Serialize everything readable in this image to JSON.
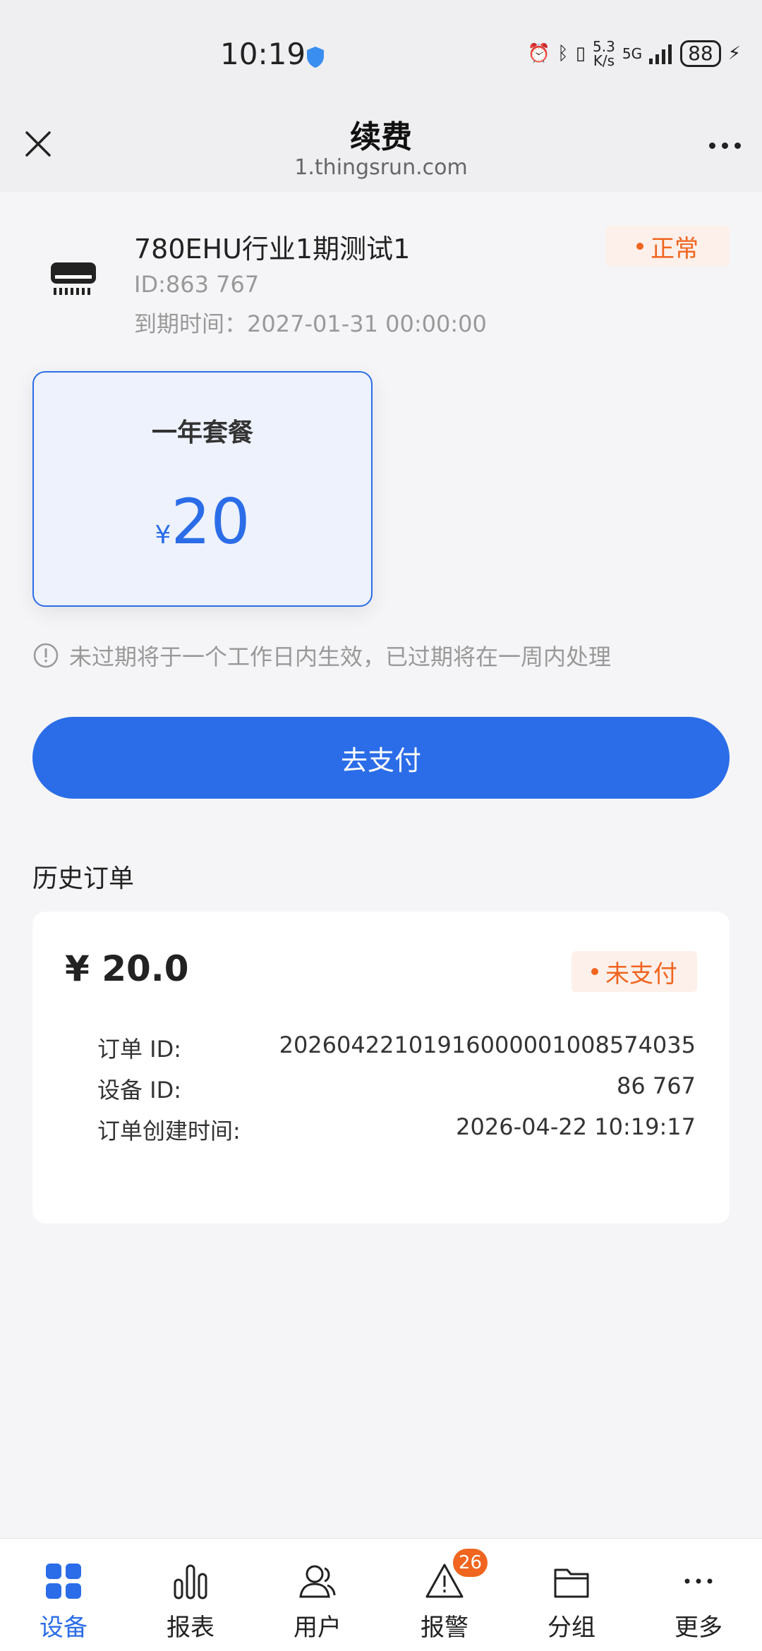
{
  "status_bar": {
    "time": "10:19",
    "net_speed_value": "5.3",
    "net_speed_unit": "K/s",
    "network": "5G",
    "battery": "88"
  },
  "nav": {
    "title": "续费",
    "url": "1.thingsrun.com"
  },
  "device": {
    "name": "780EHU行业1期测试1",
    "id": "ID:863              767",
    "expire": "到期时间：2027-01-31 00:00:00",
    "status": "正常"
  },
  "plan": {
    "name": "一年套餐",
    "currency": "¥",
    "price": "20"
  },
  "notice": "未过期将于一个工作日内生效，已过期将在一周内处理",
  "pay_button": "去支付",
  "history": {
    "title": "历史订单",
    "orders": [
      {
        "amount": "¥ 20.0",
        "status": "未支付",
        "order_id_label": "订单 ID:",
        "order_id": "20260422101916000001008574035",
        "device_id_label": "设备 ID:",
        "device_id": "86                  767",
        "created_label": "订单创建时间:",
        "created": "2026-04-22 10:19:17"
      }
    ]
  },
  "bottom_nav": {
    "tabs": [
      {
        "label": "设备",
        "icon": "grid-icon",
        "active": true
      },
      {
        "label": "报表",
        "icon": "bar-chart-icon"
      },
      {
        "label": "用户",
        "icon": "user-icon"
      },
      {
        "label": "报警",
        "icon": "warning-icon",
        "badge": "26"
      },
      {
        "label": "分组",
        "icon": "folder-icon"
      },
      {
        "label": "更多",
        "icon": "more-icon"
      }
    ]
  },
  "colors": {
    "accent": "#2b6de8",
    "warning": "#f0651f"
  }
}
